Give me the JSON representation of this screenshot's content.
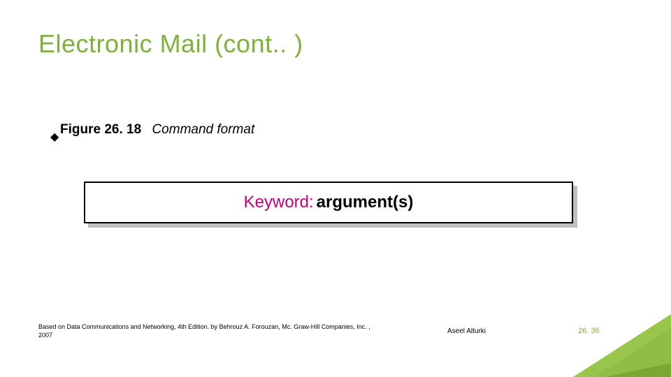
{
  "title": "Electronic Mail (cont.. )",
  "bullet": {
    "figure_ref": "Figure 26. 18",
    "caption": "Command format"
  },
  "figure": {
    "keyword_label": "Keyword:",
    "argument_label": "argument(s)"
  },
  "footer": {
    "source": "Based on Data Communications and Networking, 4th Edition. by Behrouz A. Forouzan,   Mc. Graw-Hill Companies, Inc. , 2007",
    "author": "Aseel Alturki",
    "page_number": "26. 36"
  },
  "colors": {
    "accent": "#7fb03a",
    "keyword": "#c4007a"
  }
}
